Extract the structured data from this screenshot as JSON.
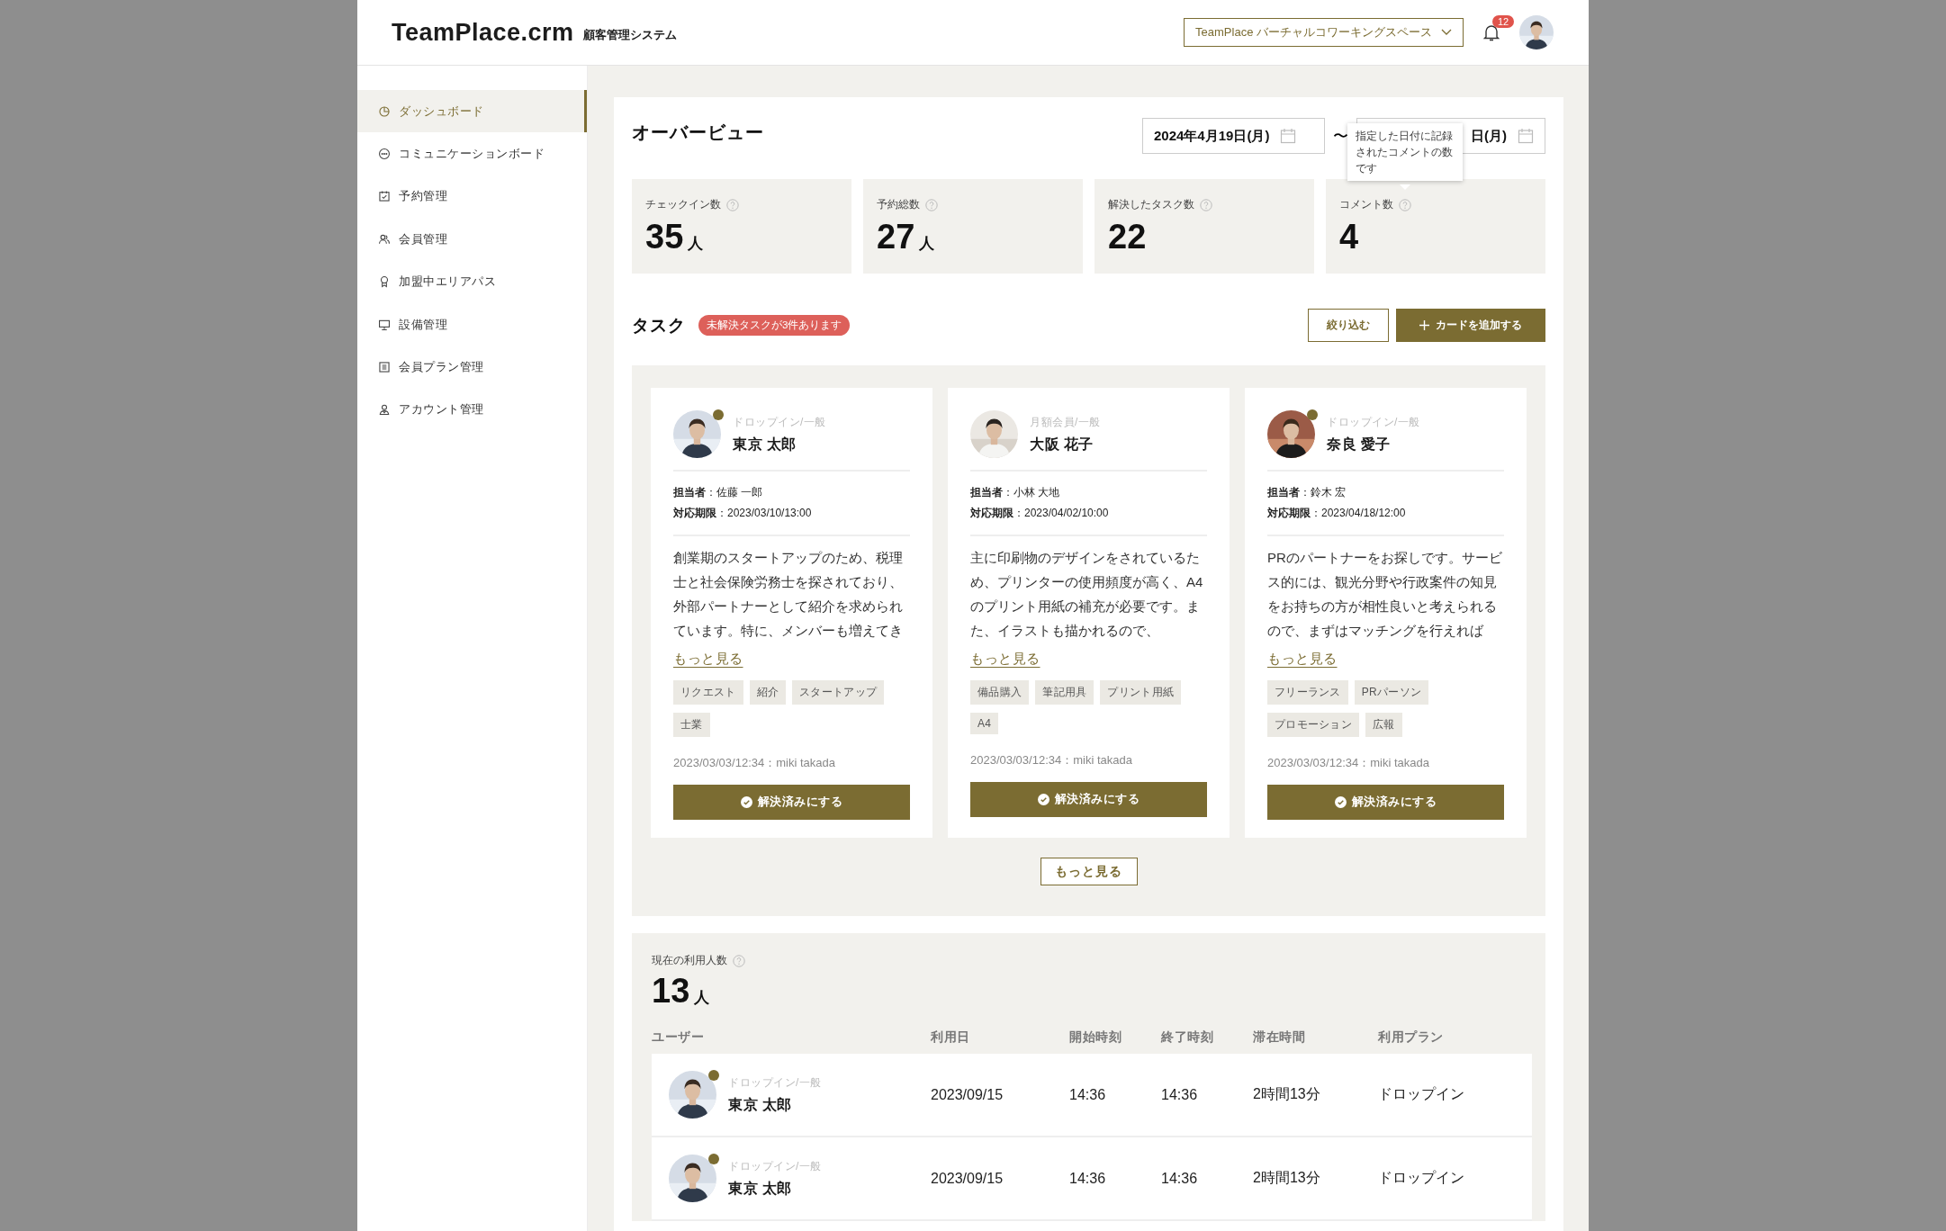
{
  "header": {
    "logo": "TeamPlace.crm",
    "subtitle": "顧客管理システム",
    "workspace": "TeamPlace バーチャルコワーキングスペース",
    "notifications": "12"
  },
  "sidebar": {
    "items": [
      {
        "label": "ダッシュボード",
        "selected": true
      },
      {
        "label": "コミュニケーションボード",
        "selected": false
      },
      {
        "label": "予約管理",
        "selected": false
      },
      {
        "label": "会員管理",
        "selected": false
      },
      {
        "label": "加盟中エリアパス",
        "selected": false
      },
      {
        "label": "設備管理",
        "selected": false
      },
      {
        "label": "会員プラン管理",
        "selected": false
      },
      {
        "label": "アカウント管理",
        "selected": false
      }
    ]
  },
  "overview": {
    "title": "オーバービュー",
    "date_start": "2024年4月19日(月)",
    "date_separator": "〜",
    "date_end": "日(月)",
    "stats": [
      {
        "label": "チェックイン数",
        "value": "35",
        "unit": "人"
      },
      {
        "label": "予約総数",
        "value": "27",
        "unit": "人"
      },
      {
        "label": "解決したタスク数",
        "value": "22"
      },
      {
        "label": "コメント数",
        "value": "4",
        "tooltip": "指定した日付に記録されたコメントの数です"
      }
    ]
  },
  "tasks": {
    "title": "タスク",
    "badge": "未解決タスクが3件あります",
    "filter_button": "絞り込む",
    "add_button": "カードを追加する",
    "more_button": "もっと見る",
    "cards": [
      {
        "plan": "ドロップイン/一般",
        "name": "東京 太郎",
        "online": true,
        "assignee": "**担当者**：佐藤 一郎",
        "due": "**対応期限**：2023/03/10/13:00",
        "body": "創業期のスタートアップのため、税理士と社会保険労務士を探されており、外部パートナーとして紹介を求められています。特に、メンバーも増えてき",
        "more_link": "もっと見る",
        "tags": [
          "リクエスト",
          "紹介",
          "スタートアップ",
          "士業"
        ],
        "meta": "2023/03/03/12:34：miki takada",
        "resolve_button": "解決済みにする"
      },
      {
        "plan": "月額会員/一般",
        "name": "大阪 花子",
        "online": false,
        "assignee": "**担当者**：小林 大地",
        "due": "**対応期限**：2023/04/02/10:00",
        "body": "主に印刷物のデザインをされているため、プリンターの使用頻度が高く、A4のプリント用紙の補充が必要です。また、イラストも描かれるので、",
        "more_link": "もっと見る",
        "tags": [
          "備品購入",
          "筆記用具",
          "プリント用紙",
          "A4"
        ],
        "meta": "2023/03/03/12:34：miki takada",
        "resolve_button": "解決済みにする"
      },
      {
        "plan": "ドロップイン/一般",
        "name": "奈良 愛子",
        "online": true,
        "assignee": "**担当者**：鈴木 宏",
        "due": "**対応期限**：2023/04/18/12:00",
        "body": "PRのパートナーをお探しです。サービス的には、観光分野や行政案件の知見をお持ちの方が相性良いと考えられるので、まずはマッチングを行えれば",
        "more_link": "もっと見る",
        "tags": [
          "フリーランス",
          "PRパーソン",
          "プロモーション",
          "広報"
        ],
        "meta": "2023/03/03/12:34：miki takada",
        "resolve_button": "解決済みにする"
      }
    ]
  },
  "usage": {
    "label": "現在の利用人数",
    "value": "13",
    "unit": "人",
    "columns": [
      "ユーザー",
      "利用日",
      "開始時刻",
      "終了時刻",
      "滞在時間",
      "利用プラン"
    ],
    "rows": [
      {
        "plan": "ドロップイン/一般",
        "name": "東京 太郎",
        "online": true,
        "date": "2023/09/15",
        "start": "14:36",
        "end": "14:36",
        "duration": "2時間13分",
        "plan_name": "ドロップイン"
      },
      {
        "plan": "ドロップイン/一般",
        "name": "東京 太郎",
        "online": true,
        "date": "2023/09/15",
        "start": "14:36",
        "end": "14:36",
        "duration": "2時間13分",
        "plan_name": "ドロップイン"
      }
    ]
  }
}
